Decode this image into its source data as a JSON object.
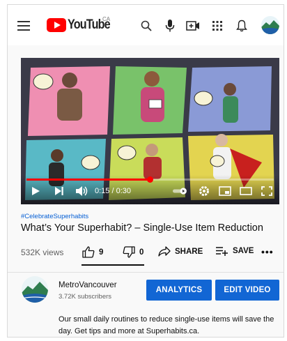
{
  "header": {
    "logo_text": "YouTube",
    "region": "CA",
    "icons": [
      "menu-icon",
      "search-icon",
      "mic-icon",
      "create-icon",
      "apps-icon",
      "bell-icon"
    ]
  },
  "player": {
    "time": "0:15 / 0:30",
    "progress": 0.5
  },
  "video": {
    "hashtag": "#CelebrateSuperhabits",
    "title": "What’s Your Superhabit? – Single-Use Item Reduction",
    "views": "532K views",
    "likes": "9",
    "dislikes": "0",
    "share_label": "SHARE",
    "save_label": "SAVE",
    "more_label": "•••"
  },
  "channel": {
    "name": "MetroVancouver",
    "subscribers": "3.72K subscribers",
    "analytics_label": "ANALYTICS",
    "edit_label": "EDIT VIDEO",
    "description": "Our small daily routines to reduce single-use items will save the day. Get tips and more at Superhabits.ca."
  },
  "colors": {
    "brand_red": "#ff0000",
    "button_blue": "#1266d4",
    "link_blue": "#065fd4"
  }
}
